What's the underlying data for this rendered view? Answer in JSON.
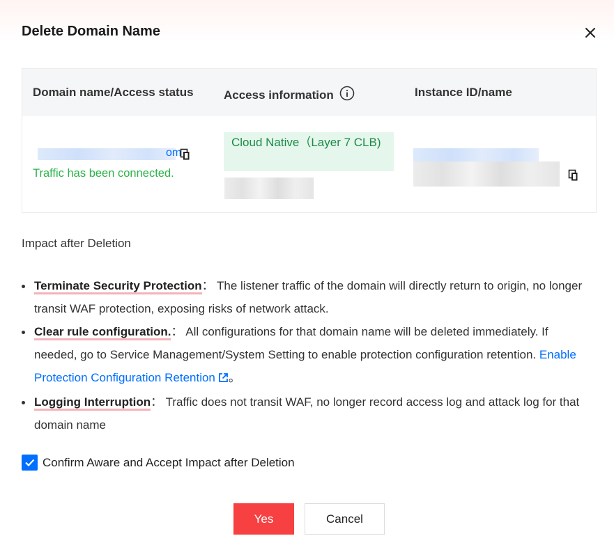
{
  "dialog": {
    "title": "Delete Domain Name"
  },
  "table": {
    "headers": {
      "domain": "Domain name/Access status",
      "access": "Access information",
      "instance": "Instance ID/name"
    },
    "row": {
      "domain_suffix": "om",
      "status": "Traffic has been connected.",
      "access_type": "Cloud Native（Layer 7 CLB)"
    }
  },
  "impact": {
    "title": "Impact after Deletion",
    "items": [
      {
        "term": "Terminate Security Protection",
        "separator": "：",
        "text": "The listener traffic of the domain will directly return to origin, no longer transit WAF protection, exposing risks of network attack."
      },
      {
        "term": "Clear rule configuration.",
        "separator": "：",
        "text": "All configurations for that domain name will be deleted immediately. If needed, go to Service Management/System Setting to enable protection configuration retention.",
        "link": "Enable Protection Configuration Retention",
        "tail": "。"
      },
      {
        "term": "Logging Interruption",
        "separator": "：",
        "text": "Traffic does not transit WAF, no longer record access log and attack log for that domain name"
      }
    ]
  },
  "confirm": {
    "label": "Confirm Aware and Accept Impact after Deletion",
    "checked": true
  },
  "buttons": {
    "yes": "Yes",
    "cancel": "Cancel"
  },
  "colors": {
    "danger": "#f64041",
    "primary": "#006eff",
    "success": "#2bb34a",
    "tag_bg": "#e5f6ec"
  }
}
